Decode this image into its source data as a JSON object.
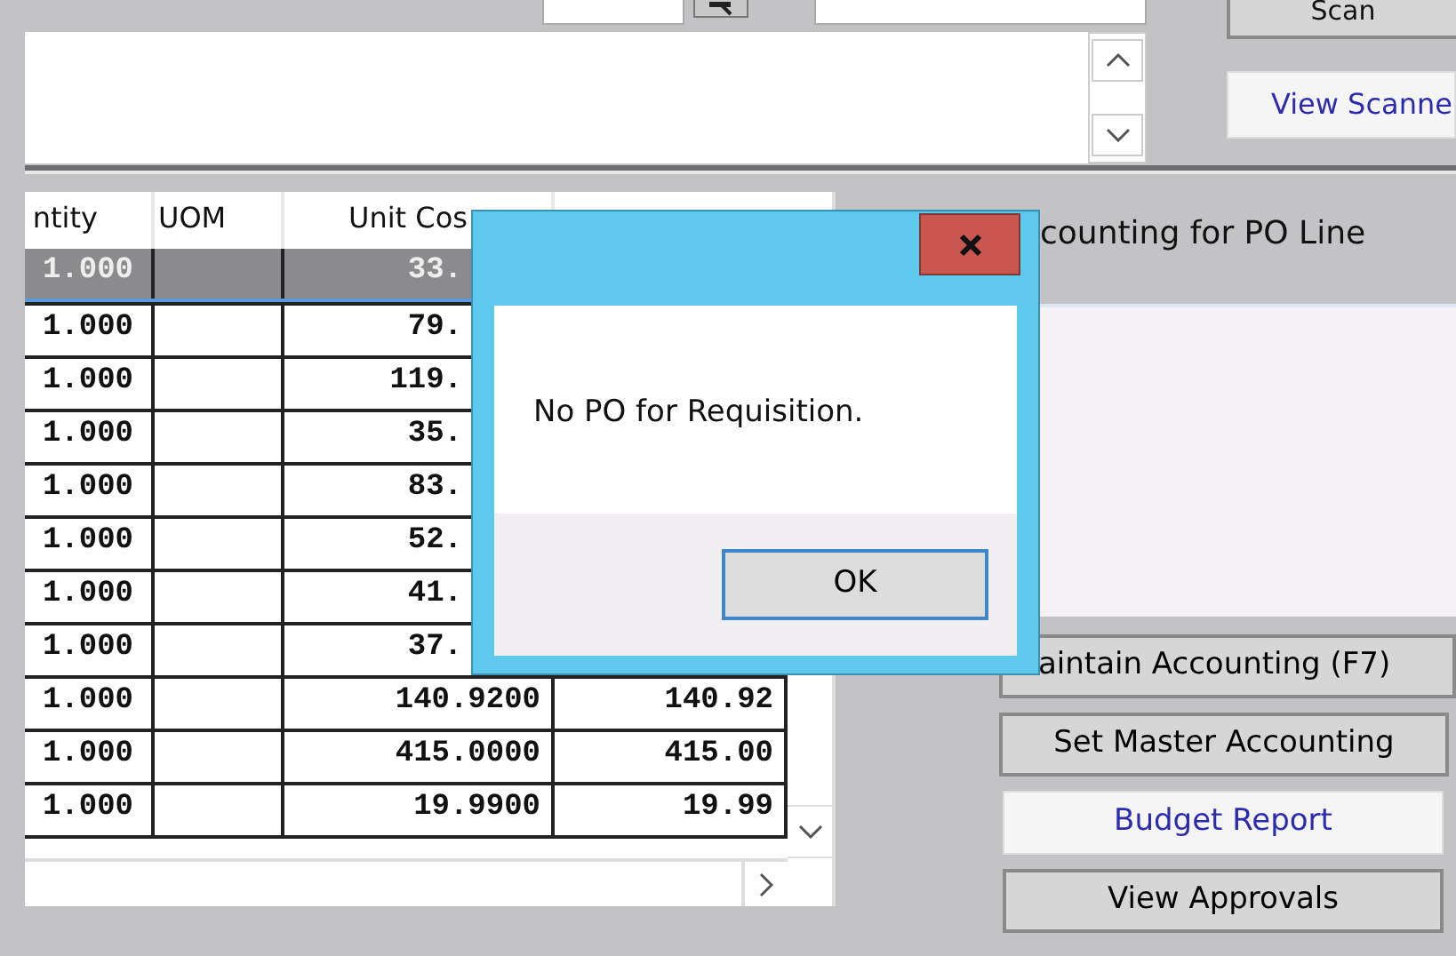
{
  "top_bar": {
    "scan_button": "Scan",
    "view_scanned_button": "View Scanne"
  },
  "table": {
    "columns": [
      "ntity",
      "UOM",
      "Unit Cos"
    ],
    "rows": [
      {
        "quantity": "1.000",
        "unit_cost": "33.",
        "selected": true
      },
      {
        "quantity": "1.000",
        "unit_cost": "79.",
        "selected": false
      },
      {
        "quantity": "1.000",
        "unit_cost": "119.",
        "selected": false
      },
      {
        "quantity": "1.000",
        "unit_cost": "35.",
        "selected": false
      },
      {
        "quantity": "1.000",
        "unit_cost": "83.",
        "selected": false
      },
      {
        "quantity": "1.000",
        "unit_cost": "52.",
        "selected": false
      },
      {
        "quantity": "1.000",
        "unit_cost": "41.",
        "selected": false
      },
      {
        "quantity": "1.000",
        "unit_cost": "37.",
        "selected": false
      },
      {
        "quantity": "1.000",
        "unit_cost": "140.9200",
        "amount": "140.92",
        "selected": false
      },
      {
        "quantity": "1.000",
        "unit_cost": "415.0000",
        "amount": "415.00",
        "selected": false
      },
      {
        "quantity": "1.000",
        "unit_cost": "19.9900",
        "amount": "19.99",
        "selected": false
      }
    ]
  },
  "accounting_panel": {
    "title": "counting for PO Line",
    "buttons": [
      {
        "label": "aintain Accounting (F7)",
        "kind": "plain"
      },
      {
        "label": "Set Master Accounting",
        "kind": "plain"
      },
      {
        "label": "Budget Report",
        "kind": "link"
      },
      {
        "label": "View Approvals",
        "kind": "plain"
      }
    ]
  },
  "dialog": {
    "message": "No PO for Requisition.",
    "ok_button": "OK"
  }
}
